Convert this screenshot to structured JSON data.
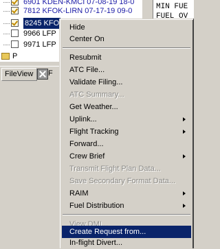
{
  "tree": {
    "rows": [
      {
        "text": "6901 KDEN-KMCI 07-08-19 18-0",
        "color": "blue",
        "checked": true
      },
      {
        "text": "7812 KFOK-LIRN 07-17-19 09-0",
        "color": "blue",
        "checked": true
      },
      {
        "text": "8245 KFO",
        "color": "selected",
        "checked": true
      },
      {
        "text": "9966 LFP",
        "color": "black",
        "checked": false
      },
      {
        "text": "9971 LFP",
        "color": "black",
        "checked": false
      }
    ],
    "folder_label": "P"
  },
  "tabs": {
    "fileview": "FileView",
    "second": "F"
  },
  "right_pane": {
    "line1": "MIN FUE",
    "line2": "FUEL OV"
  },
  "context_menu": {
    "groups": [
      [
        {
          "label": "Hide",
          "enabled": true,
          "submenu": false
        },
        {
          "label": "Center On",
          "enabled": true,
          "submenu": false
        }
      ],
      [
        {
          "label": "Resubmit",
          "enabled": true,
          "submenu": false
        },
        {
          "label": "ATC File...",
          "enabled": true,
          "submenu": false
        },
        {
          "label": "Validate Filing...",
          "enabled": true,
          "submenu": false
        },
        {
          "label": "ATC Summary...",
          "enabled": false,
          "submenu": false
        },
        {
          "label": "Get Weather...",
          "enabled": true,
          "submenu": false
        },
        {
          "label": "Uplink...",
          "enabled": true,
          "submenu": true
        },
        {
          "label": "Flight Tracking",
          "enabled": true,
          "submenu": true
        },
        {
          "label": "Forward...",
          "enabled": true,
          "submenu": false
        },
        {
          "label": "Crew Brief",
          "enabled": true,
          "submenu": true
        },
        {
          "label": "Transmit Flight Plan Data...",
          "enabled": false,
          "submenu": false
        },
        {
          "label": "Save Secondary Format Data...",
          "enabled": false,
          "submenu": false
        },
        {
          "label": "RAIM",
          "enabled": true,
          "submenu": true
        },
        {
          "label": "Fuel Distribution",
          "enabled": true,
          "submenu": true
        }
      ],
      [
        {
          "label": "View DMI...",
          "enabled": false,
          "submenu": false
        }
      ],
      [
        {
          "label": "Create Request from...",
          "enabled": true,
          "submenu": false,
          "highlighted": true
        },
        {
          "label": "In-flight Divert...",
          "enabled": true,
          "submenu": false
        }
      ]
    ]
  },
  "colors": {
    "selection": "#0a246a",
    "face": "#d4d0c8",
    "tree_text_blue": "#1a1aa6"
  }
}
